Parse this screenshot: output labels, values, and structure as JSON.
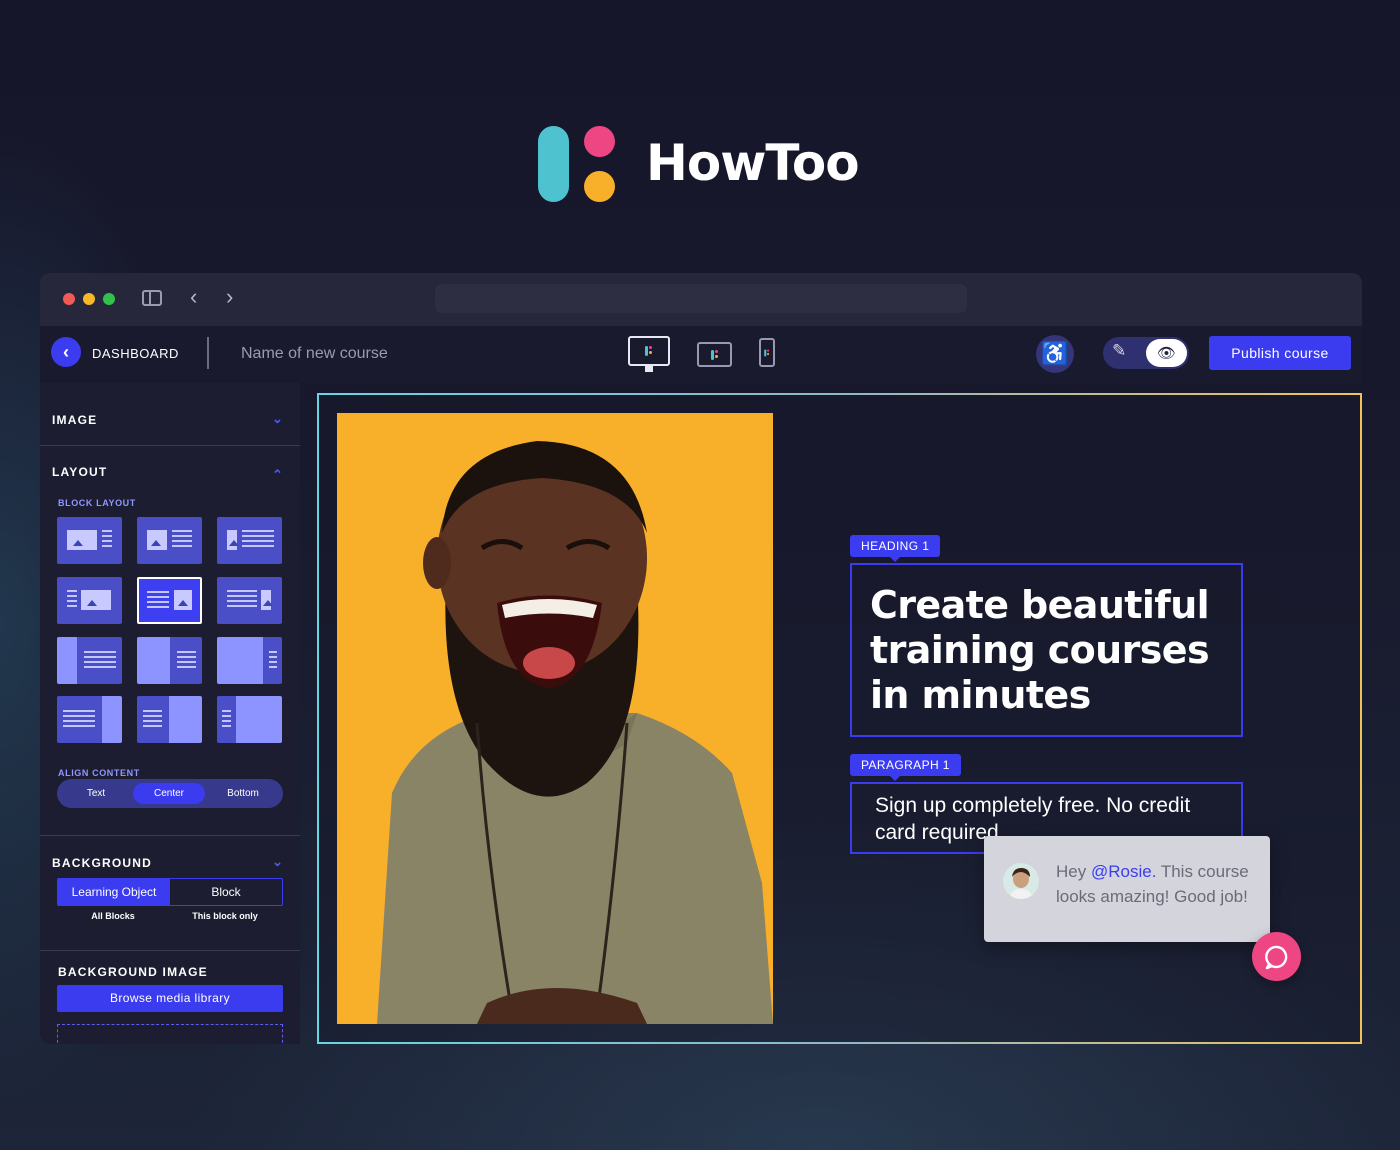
{
  "brand": {
    "name": "HowToo"
  },
  "topbar": {
    "back_label": "‹",
    "dashboard": "DASHBOARD",
    "course_name": "Name of new course",
    "edit_icon": "✎",
    "view_icon": "👁",
    "accessibility_icon": "♿",
    "publish": "Publish course"
  },
  "window": {
    "back_arrow": "‹",
    "forward_arrow": "›"
  },
  "sidebar": {
    "image_title": "IMAGE",
    "layout_title": "LAYOUT",
    "block_layout": "BLOCK LAYOUT",
    "align_content": "ALIGN CONTENT",
    "align_options": [
      "Text",
      "Center",
      "Bottom"
    ],
    "align_selected": "Center",
    "background_title": "BACKGROUND",
    "bg_tabs": [
      "Learning Object",
      "Block"
    ],
    "bg_captions": [
      "All Blocks",
      "This block only"
    ],
    "bg_image_title": "BACKGROUND IMAGE",
    "browse": "Browse media library",
    "chevron_down": "⌄",
    "chevron_up": "⌃"
  },
  "canvas": {
    "heading_tag": "HEADING 1",
    "heading": "Create beautiful training courses in minutes",
    "paragraph_tag": "PARAGRAPH 1",
    "paragraph": "Sign up completely free. No credit card required."
  },
  "comment": {
    "greeting": "Hey ",
    "mention": "@Rosie.",
    "text": " This course looks amazing! Good job!"
  },
  "colors": {
    "accent": "#3b3cf0",
    "brand_teal": "#4ec3cf",
    "brand_pink": "#ee4583",
    "brand_yellow": "#f8b02a"
  }
}
